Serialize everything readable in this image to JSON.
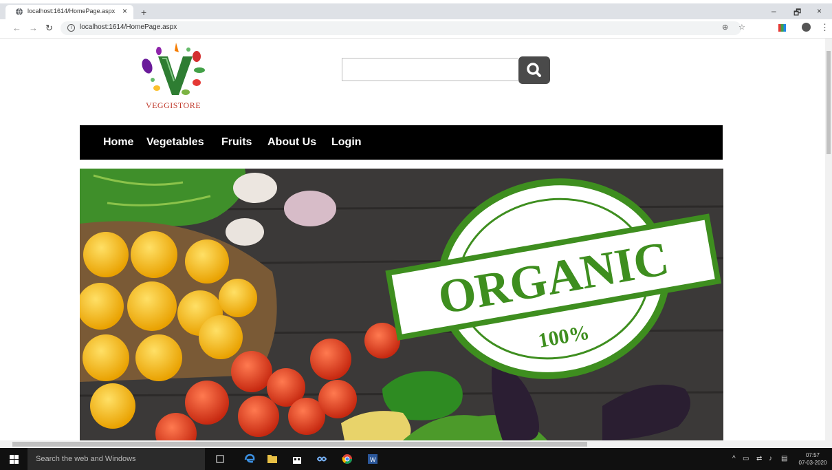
{
  "browser": {
    "tab_title": "localhost:1614/HomePage.aspx",
    "tab_close": "×",
    "new_tab": "+",
    "url": "localhost:1614/HomePage.aspx",
    "window_minimize": "–",
    "window_restore": "🗗",
    "window_close": "×"
  },
  "site": {
    "logo_text": "VEGGISTORE",
    "search": {
      "value": "",
      "placeholder": ""
    },
    "nav": [
      "Home",
      "Vegetables",
      "Fruits",
      "About Us",
      "Login"
    ],
    "hero": {
      "stamp_text": "ORGANIC",
      "stamp_percent": "100%"
    }
  },
  "taskbar": {
    "search_placeholder": "Search the web and Windows",
    "time": "07:57",
    "date": "07-03-2020"
  },
  "colors": {
    "nav_bg": "#000000",
    "stamp_green": "#3e8e1f",
    "search_button": "#4a4a4a"
  }
}
